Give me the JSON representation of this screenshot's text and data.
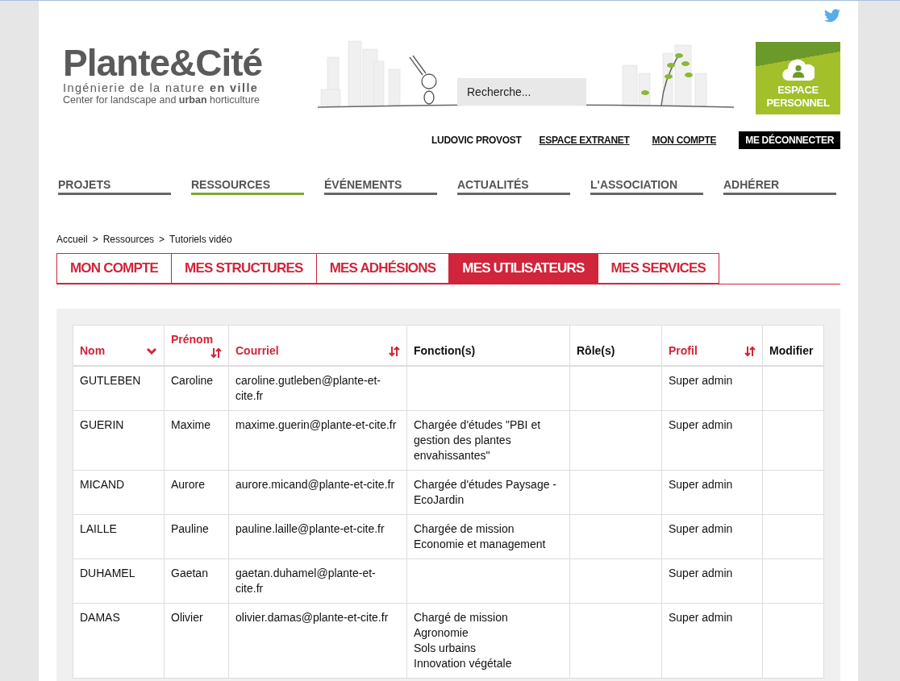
{
  "header": {
    "logo": {
      "title": "Plante**&**Cité",
      "tagline": "Ingénierie de la nature **en ville**",
      "subtitle": "Center for landscape and **urban** horticulture"
    },
    "search": {
      "placeholder": "Recherche..."
    },
    "personal_space": "ESPACE PERSONNEL",
    "user_links": [
      {
        "label": "LUDOVIC PROVOST",
        "kind": "name"
      },
      {
        "label": "ESPACE EXTRANET",
        "kind": "link"
      },
      {
        "label": "MON COMPTE",
        "kind": "link"
      },
      {
        "label": "ME DÉCONNECTER",
        "kind": "button"
      }
    ]
  },
  "nav": [
    {
      "label": "PROJETS",
      "selected": false
    },
    {
      "label": "RESSOURCES",
      "selected": true
    },
    {
      "label": "ÉVÉNEMENTS",
      "selected": false
    },
    {
      "label": "ACTUALITÉS",
      "selected": false
    },
    {
      "label": "L'ASSOCIATION",
      "selected": false
    },
    {
      "label": "ADHÉRER",
      "selected": false
    }
  ],
  "breadcrumb": [
    "Accueil",
    ">",
    "Ressources",
    ">",
    "Tutoriels vidéo"
  ],
  "tabs": [
    {
      "label": "MON COMPTE",
      "selected": false
    },
    {
      "label": "MES STRUCTURES",
      "selected": false
    },
    {
      "label": "MES ADHÉSIONS",
      "selected": false
    },
    {
      "label": "MES UTILISATEURS",
      "selected": true
    },
    {
      "label": "MES SERVICES",
      "selected": false
    }
  ],
  "table": {
    "columns": [
      {
        "label": "Nom",
        "kind": "sorted"
      },
      {
        "label": "Prénom",
        "kind": "sortable"
      },
      {
        "label": "Courriel",
        "kind": "sortable"
      },
      {
        "label": "Fonction(s)",
        "kind": "plain"
      },
      {
        "label": "Rôle(s)",
        "kind": "plain"
      },
      {
        "label": "Profil",
        "kind": "sortable"
      },
      {
        "label": "Modifier",
        "kind": "plain"
      }
    ],
    "rows": [
      {
        "nom": "GUTLEBEN",
        "prenom": "Caroline",
        "courriel": "caroline.gutleben@plante-et-cite.fr",
        "fonctions": [],
        "profil": "Super admin"
      },
      {
        "nom": "GUERIN",
        "prenom": "Maxime",
        "courriel": "maxime.guerin@plante-et-cite.fr",
        "fonctions": [
          "Chargée d'études \"PBI et gestion des plantes envahissantes\""
        ],
        "profil": "Super admin"
      },
      {
        "nom": "MICAND",
        "prenom": "Aurore",
        "courriel": "aurore.micand@plante-et-cite.fr",
        "fonctions": [
          "Chargée d'études Paysage - EcoJardin"
        ],
        "profil": "Super admin"
      },
      {
        "nom": "LAILLE",
        "prenom": "Pauline",
        "courriel": "pauline.laille@plante-et-cite.fr",
        "fonctions": [
          "Chargée de mission",
          "Economie et management"
        ],
        "profil": "Super admin"
      },
      {
        "nom": "DUHAMEL",
        "prenom": "Gaetan",
        "courriel": "gaetan.duhamel@plante-et-cite.fr",
        "fonctions": [],
        "profil": "Super admin"
      },
      {
        "nom": "DAMAS",
        "prenom": "Olivier",
        "courriel": "olivier.damas@plante-et-cite.fr",
        "fonctions": [
          "Chargé de mission",
          "Agronomie",
          "Sols urbains",
          "Innovation végétale"
        ],
        "profil": "Super admin"
      }
    ]
  }
}
